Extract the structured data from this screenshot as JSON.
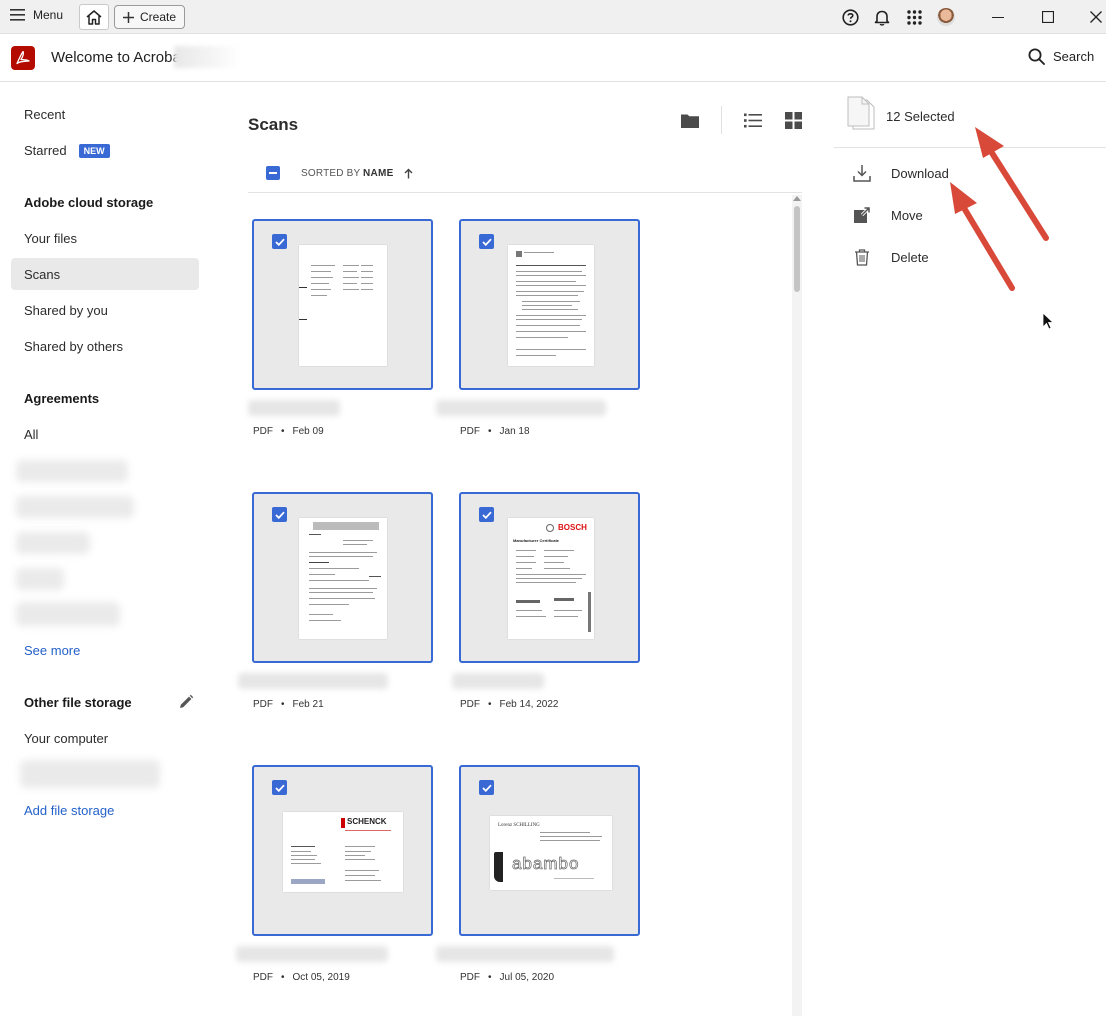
{
  "titlebar": {
    "menu_label": "Menu",
    "create_label": "Create",
    "icons": [
      "help-icon",
      "bell-icon",
      "apps-grid-icon",
      "avatar"
    ]
  },
  "header": {
    "welcome": "Welcome to Acrobat,",
    "search_label": "Search"
  },
  "nav": {
    "recent": "Recent",
    "starred": "Starred",
    "new_badge": "NEW",
    "cloud_heading": "Adobe cloud storage",
    "your_files": "Your files",
    "scans": "Scans",
    "shared_by_you": "Shared by you",
    "shared_by_others": "Shared by others",
    "agreements_heading": "Agreements",
    "all": "All",
    "see_more": "See more",
    "other_heading": "Other file storage",
    "your_computer": "Your computer",
    "add_storage": "Add file storage"
  },
  "main": {
    "title": "Scans",
    "sorted_by": "SORTED BY",
    "sort_field": "NAME",
    "files": [
      {
        "type": "PDF",
        "date": "Feb 09"
      },
      {
        "type": "PDF",
        "date": "Jan 18"
      },
      {
        "type": "PDF",
        "date": "Feb 21"
      },
      {
        "type": "PDF",
        "date": "Feb 14, 2022"
      },
      {
        "type": "PDF",
        "date": "Oct 05, 2019"
      },
      {
        "type": "PDF",
        "date": "Jul 05, 2020"
      }
    ],
    "thumb_texts": {
      "bosch": "BOSCH",
      "bosch_sub": "Manufacturer Certificate",
      "schenck": "SCHENCK",
      "schilling": "Lorenz SCHILLING",
      "abambo": "abambo"
    }
  },
  "panel": {
    "selected": "12 Selected",
    "download": "Download",
    "move": "Move",
    "delete": "Delete"
  },
  "colors": {
    "accent": "#3869d4",
    "acrobat_red": "#b30b00",
    "annotation_arrow": "#d9493a"
  }
}
